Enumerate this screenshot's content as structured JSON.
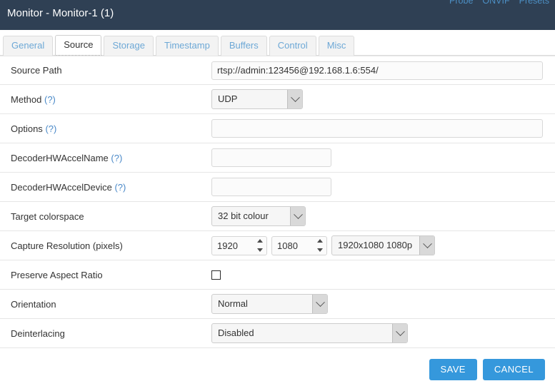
{
  "header": {
    "title": "Monitor - Monitor-1 (1)",
    "links": [
      {
        "label": "Probe",
        "name": "probe-link"
      },
      {
        "label": "ONVIF",
        "name": "onvif-link"
      },
      {
        "label": "Presets",
        "name": "presets-link"
      }
    ],
    "bg_color": "#2f4054",
    "link_color": "#4c8fc4"
  },
  "tabs": [
    {
      "label": "General",
      "active": false
    },
    {
      "label": "Source",
      "active": true
    },
    {
      "label": "Storage",
      "active": false
    },
    {
      "label": "Timestamp",
      "active": false
    },
    {
      "label": "Buffers",
      "active": false
    },
    {
      "label": "Control",
      "active": false
    },
    {
      "label": "Misc",
      "active": false
    }
  ],
  "form": {
    "source_path": {
      "label": "Source Path",
      "value": "rtsp://admin:123456@192.168.1.6:554/",
      "placeholder": ""
    },
    "method": {
      "label": "Method",
      "hint": "(?)",
      "value": "UDP"
    },
    "options": {
      "label": "Options",
      "hint": "(?)",
      "value": "",
      "placeholder": ""
    },
    "decoder_hwaccel_name": {
      "label": "DecoderHWAccelName",
      "hint": "(?)",
      "value": "",
      "placeholder": ""
    },
    "decoder_hwaccel_device": {
      "label": "DecoderHWAccelDevice",
      "hint": "(?)",
      "value": "",
      "placeholder": ""
    },
    "target_colorspace": {
      "label": "Target colorspace",
      "value": "32 bit colour"
    },
    "capture_resolution": {
      "label": "Capture Resolution (pixels)",
      "width": "1920",
      "height": "1080",
      "preset": "1920x1080 1080p"
    },
    "preserve_aspect_ratio": {
      "label": "Preserve Aspect Ratio",
      "checked": false
    },
    "orientation": {
      "label": "Orientation",
      "value": "Normal"
    },
    "deinterlacing": {
      "label": "Deinterlacing",
      "value": "Disabled"
    }
  },
  "footer": {
    "save_label": "SAVE",
    "cancel_label": "CANCEL",
    "button_color": "#3598dc"
  }
}
